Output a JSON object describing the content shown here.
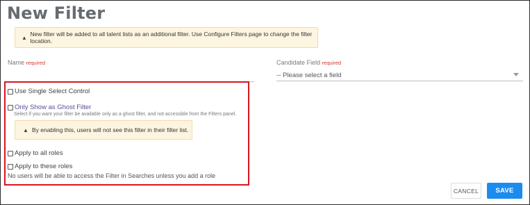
{
  "page": {
    "title": "New Filter",
    "notice": "New filter will be added to all talent lists as an additional filter. Use Configure Filters page to change the filter location."
  },
  "form": {
    "name_label": "Name",
    "required_text": "required",
    "candidate_field_label": "Candidate Field",
    "candidate_field_placeholder": "-- Please select a field"
  },
  "options": {
    "single_select_label": "Use Single Select Control",
    "ghost_label": "Only Show as Ghost Filter",
    "ghost_help": "Select if you want your filter be available only as a ghost filter, and not accessible from the Filters panel.",
    "ghost_warning": "By enabling this, users will not see this filter in their filter list.",
    "all_roles_label": "Apply to all roles",
    "these_roles_label": "Apply to these roles",
    "roles_note": "No users will be able to access the Filter in Searches unless you add a role"
  },
  "actions": {
    "cancel_label": "CANCEL",
    "save_label": "SAVE"
  },
  "colors": {
    "accent": "#1a8cf0",
    "highlight_border": "#d9141e",
    "required": "#d9352b",
    "warning_bg": "#fdf5e0"
  },
  "icons": {
    "warning": "warning-icon",
    "dropdown": "chevron-down-icon"
  }
}
